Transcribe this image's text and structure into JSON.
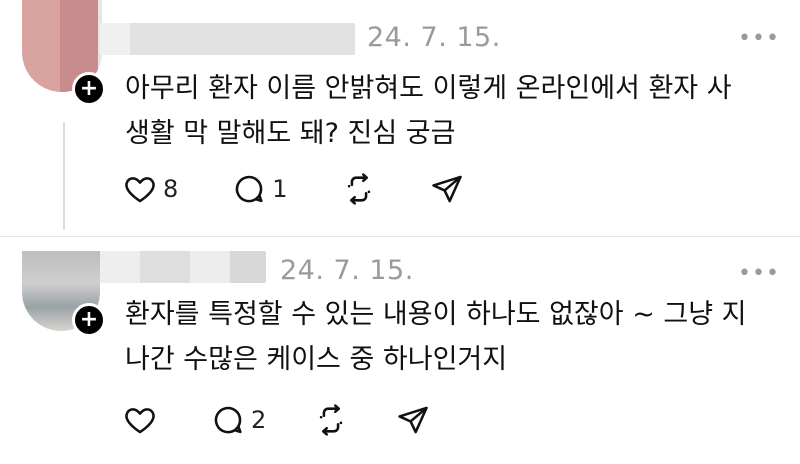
{
  "posts": [
    {
      "date": "24. 7. 15.",
      "more": "•••",
      "text_line1": "아무리 환자 이름 안밝혀도 이렇게 온라인에서 환자 사",
      "text_line2": "생활 막 말해도 돼? 진심 궁금",
      "likes": "8",
      "replies": "1",
      "icons": [
        "heart-icon",
        "comment-icon",
        "repost-icon",
        "share-icon"
      ]
    },
    {
      "date": "24. 7. 15.",
      "more": "•••",
      "text_line1": "환자를 특정할 수 있는 내용이 하나도 없잖아 ~ 그냥 지",
      "text_line2": "나간 수많은 케이스 중 하나인거지",
      "likes": "",
      "replies": "2",
      "icons": [
        "heart-icon",
        "comment-icon",
        "repost-icon",
        "share-icon"
      ]
    }
  ]
}
